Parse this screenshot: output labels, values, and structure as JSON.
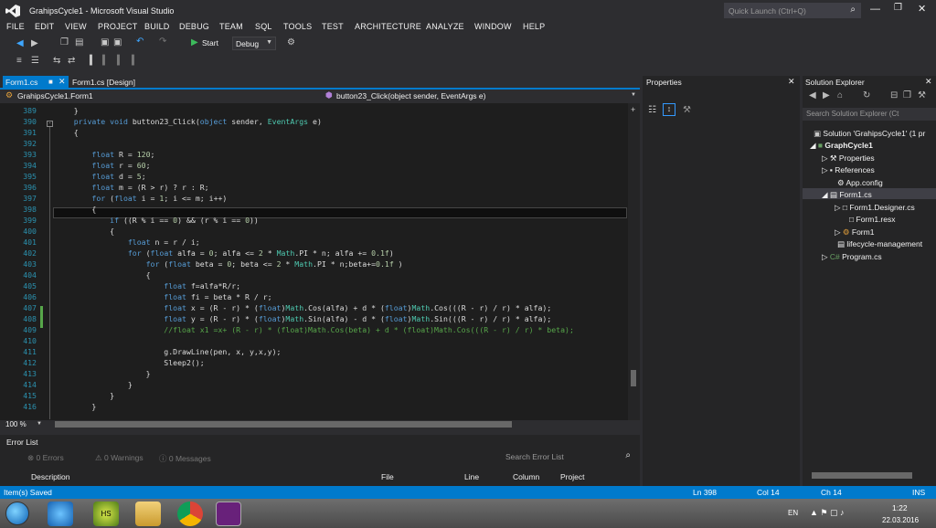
{
  "window": {
    "title": "GrahipsCycle1 - Microsoft Visual Studio",
    "quick_launch_placeholder": "Quick Launch (Ctrl+Q)"
  },
  "menu": [
    "FILE",
    "EDIT",
    "VIEW",
    "PROJECT",
    "BUILD",
    "DEBUG",
    "TEAM",
    "SQL",
    "TOOLS",
    "TEST",
    "ARCHITECTURE",
    "ANALYZE",
    "WINDOW",
    "HELP"
  ],
  "toolbar": {
    "start_label": "Start",
    "config_label": "Debug"
  },
  "tabs": [
    {
      "label": "Form1.cs"
    },
    {
      "label": "Form1.cs [Design]"
    }
  ],
  "nav": {
    "class_dropdown": "GrahipsCycle1.Form1",
    "member_dropdown": "button23_Click(object sender, EventArgs e)"
  },
  "editor": {
    "zoom": "100 %",
    "lines": [
      {
        "n": "389",
        "t": "    }"
      },
      {
        "n": "390",
        "t": "    private void button23_Click(object sender, EventArgs e)"
      },
      {
        "n": "391",
        "t": "    {"
      },
      {
        "n": "392",
        "t": ""
      },
      {
        "n": "393",
        "t": "        float R = 120;"
      },
      {
        "n": "394",
        "t": "        float r = 60;"
      },
      {
        "n": "395",
        "t": "        float d = 5;"
      },
      {
        "n": "396",
        "t": "        float m = (R > r) ? r : R;"
      },
      {
        "n": "397",
        "t": "        for (float i = 1; i <= m; i++)"
      },
      {
        "n": "398",
        "t": "        {"
      },
      {
        "n": "399",
        "t": "            if ((R % i == 0) && (r % i == 0))"
      },
      {
        "n": "400",
        "t": "            {"
      },
      {
        "n": "401",
        "t": "                float n = r / i;"
      },
      {
        "n": "402",
        "t": "                for (float alfa = 0; alfa <= 2 * Math.PI * n; alfa += 0.1f)"
      },
      {
        "n": "403",
        "t": "                    for (float beta = 0; beta <= 2 * Math.PI * n;beta+=0.1f )"
      },
      {
        "n": "404",
        "t": "                    {"
      },
      {
        "n": "405",
        "t": "                        float f=alfa*R/r;"
      },
      {
        "n": "406",
        "t": "                        float fi = beta * R / r;"
      },
      {
        "n": "407",
        "t": "                        float x = (R - r) * (float)Math.Cos(alfa) + d * (float)Math.Cos(((R - r) / r) * alfa);"
      },
      {
        "n": "408",
        "t": "                        float y = (R - r) * (float)Math.Sin(alfa) - d * (float)Math.Sin(((R - r) / r) * alfa);"
      },
      {
        "n": "409",
        "t": "                        //float x1 =x+ (R - r) * (float)Math.Cos(beta) + d * (float)Math.Cos(((R - r) / r) * beta);"
      },
      {
        "n": "410",
        "t": ""
      },
      {
        "n": "411",
        "t": "                        g.DrawLine(pen, x, y,x,y);"
      },
      {
        "n": "412",
        "t": "                        Sleep2();"
      },
      {
        "n": "413",
        "t": "                    }"
      },
      {
        "n": "414",
        "t": "                }"
      },
      {
        "n": "415",
        "t": "            }"
      },
      {
        "n": "416",
        "t": "        }"
      }
    ]
  },
  "properties": {
    "title": "Properties"
  },
  "solution_explorer": {
    "title": "Solution Explorer",
    "search_placeholder": "Search Solution Explorer (Ct",
    "items": [
      {
        "label": "Solution 'GrahipsCycle1' (1 pr"
      },
      {
        "label": "GraphCycle1"
      },
      {
        "label": "Properties"
      },
      {
        "label": "References"
      },
      {
        "label": "App.config"
      },
      {
        "label": "Form1.cs"
      },
      {
        "label": "Form1.Designer.cs"
      },
      {
        "label": "Form1.resx"
      },
      {
        "label": "Form1"
      },
      {
        "label": "lifecycle-management"
      },
      {
        "label": "Program.cs"
      }
    ]
  },
  "error_list": {
    "title": "Error List",
    "errors": "0 Errors",
    "warnings": "0 Warnings",
    "messages": "0 Messages",
    "search_placeholder": "Search Error List",
    "columns": [
      "Description",
      "File",
      "Line",
      "Column",
      "Project"
    ]
  },
  "status": {
    "message": "Item(s) Saved",
    "ln": "Ln 398",
    "col": "Col 14",
    "ch": "Ch 14",
    "mode": "INS"
  },
  "taskbar": {
    "lang": "EN",
    "time": "1:22",
    "date": "22.03.2016"
  }
}
